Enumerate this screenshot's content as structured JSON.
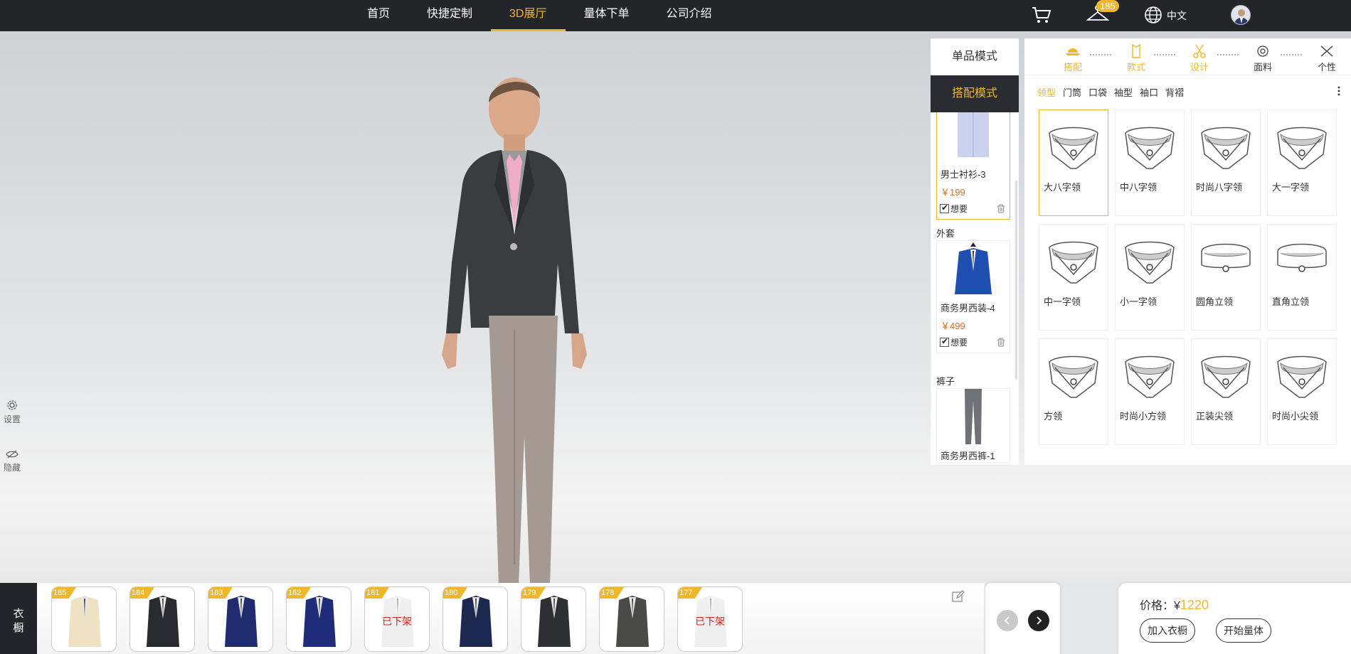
{
  "nav": {
    "items": [
      "首页",
      "快捷定制",
      "3D展厅",
      "量体下单",
      "公司介绍"
    ],
    "active_index": 2,
    "hanger_badge": "185",
    "language": "中文"
  },
  "side": {
    "settings": "设置",
    "hide": "隐藏"
  },
  "modes": {
    "single": "单品模式",
    "combo": "搭配模式"
  },
  "items": [
    {
      "category": "",
      "name": "男士衬衫-3",
      "price": "￥199",
      "want": "想要"
    },
    {
      "category": "外套",
      "name": "商务男西装-4",
      "price": "￥499",
      "want": "想要"
    },
    {
      "category": "裤子",
      "name": "商务男西裤-1",
      "price": "",
      "want": ""
    }
  ],
  "steps": [
    {
      "label": "搭配",
      "icon": "hat-icon"
    },
    {
      "label": "款式",
      "icon": "shirt-icon"
    },
    {
      "label": "设计",
      "icon": "scissors-icon"
    },
    {
      "label": "面料",
      "icon": "fabric-roll-icon"
    },
    {
      "label": "个性",
      "icon": "tools-icon"
    }
  ],
  "subtabs": [
    "领型",
    "门筒",
    "口袋",
    "袖型",
    "袖口",
    "背褶"
  ],
  "collars": [
    "大八字领",
    "中八字领",
    "时尚八字领",
    "大一字领",
    "中一字领",
    "小一字领",
    "圆角立领",
    "直角立领",
    "方领",
    "时尚小方领",
    "正装尖领",
    "时尚小尖领"
  ],
  "wardrobe": {
    "tab": "衣橱",
    "thumbs": [
      {
        "badge": "185",
        "color": "#efe2c4",
        "off": ""
      },
      {
        "badge": "184",
        "color": "#2a2b30",
        "off": ""
      },
      {
        "badge": "183",
        "color": "#1f2c6e",
        "off": ""
      },
      {
        "badge": "182",
        "color": "#1f2c7a",
        "off": ""
      },
      {
        "badge": "181",
        "color": "#dcdcdc",
        "off": "已下架"
      },
      {
        "badge": "180",
        "color": "#1d2850",
        "off": ""
      },
      {
        "badge": "179",
        "color": "#2e2f33",
        "off": ""
      },
      {
        "badge": "178",
        "color": "#4a4b48",
        "off": ""
      },
      {
        "badge": "177",
        "color": "#dcdcdc",
        "off": "已下架"
      }
    ]
  },
  "price": {
    "label": "价格：¥",
    "value": "1220",
    "add": "加入衣橱",
    "measure": "开始量体"
  },
  "colors": {
    "accent": "#f1b62a",
    "dark": "#242529",
    "price": "#d76b2b"
  }
}
